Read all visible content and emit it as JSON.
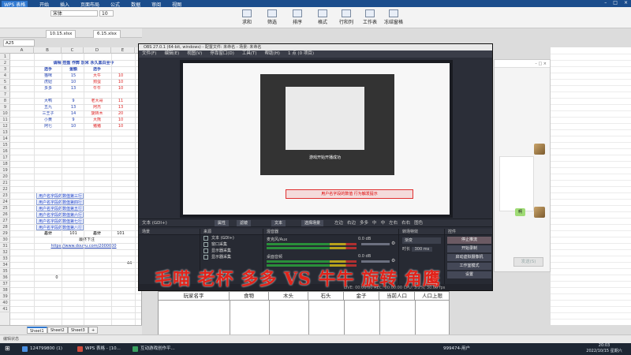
{
  "wps": {
    "app_title": "WPS 表格",
    "menus": [
      "开始",
      "插入",
      "页面布局",
      "公式",
      "数据",
      "审阅",
      "视图"
    ],
    "font_name": "宋体",
    "font_size": "10",
    "ribbon_buttons": [
      "求和",
      "筛选",
      "排序",
      "格式",
      "行和列",
      "工作表",
      "冻结窗格"
    ],
    "file_tabs": [
      "10.15.xlsx",
      "6.15.xlsx"
    ],
    "name_box": "A25"
  },
  "sheet": {
    "columns": [
      "A",
      "B",
      "C",
      "D",
      "E"
    ],
    "rows": [
      "1",
      "2",
      "3",
      "4",
      "5",
      "6",
      "7",
      "8",
      "9",
      "10",
      "11",
      "12",
      "13",
      "14",
      "15",
      "16",
      "17",
      "18",
      "19",
      "20",
      "21",
      "22",
      "23",
      "24",
      "25",
      "26",
      "27",
      "28",
      "29",
      "30",
      "31",
      "32",
      "33",
      "34",
      "35",
      "36",
      "37",
      "38",
      "39",
      "40",
      "41"
    ],
    "header_row": "请相 控盘 作弊 加米 永久黑白至今",
    "subheaders": [
      "选手",
      "金额",
      "选手"
    ],
    "left_names": [
      "猫咪",
      "虎妞",
      "多多",
      "",
      "大鸭",
      "五九",
      "三王子",
      "小黄",
      "阿七"
    ],
    "mid_values": [
      "15",
      "10",
      "13",
      "",
      "9",
      "13",
      "14",
      "9",
      "10"
    ],
    "right_names": [
      "大牛",
      "狗蛋",
      "牛牛",
      "",
      "老大哥",
      "阿杰",
      "旋转木",
      "大熊",
      "猪猪"
    ],
    "right_values": [
      "10",
      "10",
      "10",
      "",
      "11",
      "13",
      "20",
      "10",
      "10"
    ],
    "link_rows": [
      "用户名字段的数值第三行",
      "用户名字段的数值第四行",
      "用户名字段的数值第五行",
      "用户名字段的数值第六行",
      "用户名字段的数值第七行",
      "用户名字段的数值第八行"
    ],
    "total_label_left": "总计",
    "total_value_left": "101",
    "total_label_right": "总计",
    "total_value_right": "101",
    "note_label": "最终下注",
    "url": "https://www.douyu.com/2000000",
    "side_number": "44",
    "zero_value": "0",
    "sheet_tabs": [
      "Sheet1",
      "Sheet2",
      "Sheet3"
    ]
  },
  "obs": {
    "title": "OBS 27.0.1 (64-bit, windows) - 配置文件: 未命名 - 场景: 未命名",
    "menu": [
      "文件(F)",
      "编辑(E)",
      "视图(V)",
      "停靠窗口(D)",
      "工具(T)",
      "帮助(H)",
      "1 点 (0 项目)"
    ],
    "red_banner": "用户名字段的数值 行为触发提示",
    "preview_caption": "游戏开始开播成功",
    "ctrl_left": "文本 (GDI+)",
    "ctrl_tags": [
      "属性",
      "滤镜",
      "文本"
    ],
    "ctrl_scene": "选择场景",
    "ctrl_right": [
      "左边",
      "右边",
      "多多",
      "中",
      "中",
      "左右",
      "右右",
      "图色"
    ],
    "docks": {
      "scenes": "场景",
      "sources": "来源",
      "mixer": "混音器",
      "transitions": "转场特效",
      "controls": "控件"
    },
    "sources": [
      "文本 (GDI+)",
      "窗口采集",
      "显示器采集",
      "显示器采集"
    ],
    "mixer_tracks": [
      "麦克风/Aux",
      "桌面音频"
    ],
    "mixer_db": [
      "0.0 dB",
      "0.0 dB"
    ],
    "transition": "渐变",
    "duration_label": "时长",
    "duration_value": "300 ms",
    "controls": [
      "停止推流",
      "开始录制",
      "启动虚拟摄像机",
      "工作室模式",
      "设置",
      "退出"
    ],
    "status": "LIVE: 00:00:00  REC: 00:00:00  CPU: 3.2%, 30.00 fps"
  },
  "overlay": {
    "headline": "毛喵 老杯 多多 VS 牛牛 旋转 角鹰"
  },
  "bottom_table": {
    "headers": [
      "玩家名字",
      "食物",
      "木头",
      "石头",
      "金子",
      "当前人口",
      "人口上限"
    ]
  },
  "chat": {
    "bubble": "啊",
    "send_label": "发送(S)"
  },
  "taskbar": {
    "items": [
      "124799800 (1)",
      "WPS 表格 - [10...",
      "互动游戏创作平..."
    ],
    "tray_text": "999474-用户",
    "time": "20:03",
    "date": "2022/10/15 星期六"
  },
  "status_line": "编辑状态"
}
